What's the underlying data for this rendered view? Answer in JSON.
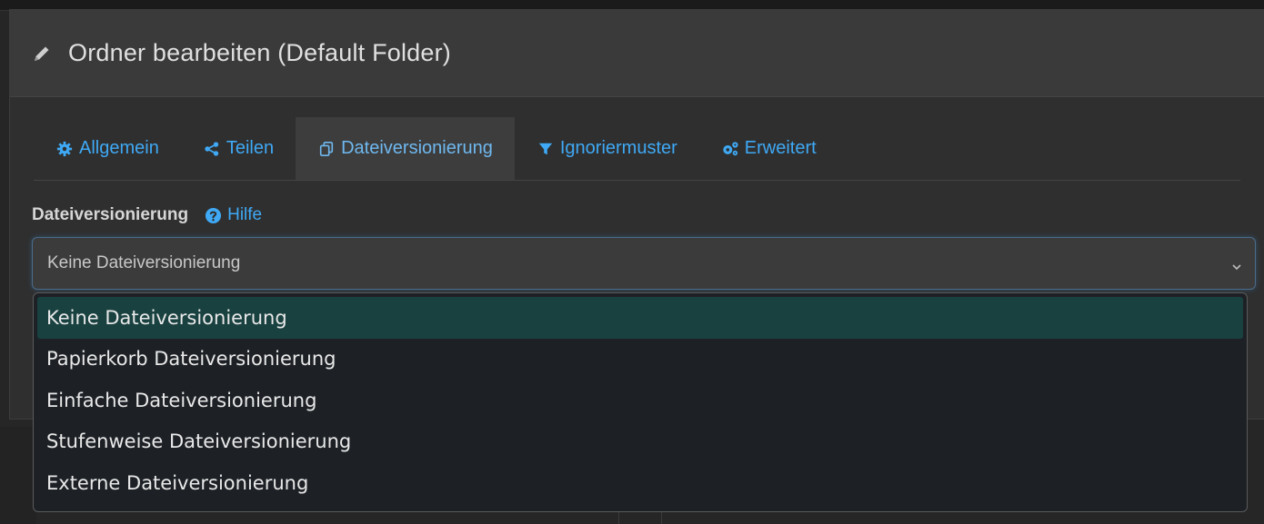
{
  "modal": {
    "title": "Ordner bearbeiten (Default Folder)"
  },
  "tabs": [
    {
      "label": "Allgemein",
      "icon": "gear-icon",
      "active": false
    },
    {
      "label": "Teilen",
      "icon": "share-icon",
      "active": false
    },
    {
      "label": "Dateiversionierung",
      "icon": "copy-icon",
      "active": true
    },
    {
      "label": "Ignoriermuster",
      "icon": "filter-icon",
      "active": false
    },
    {
      "label": "Erweitert",
      "icon": "gears-icon",
      "active": false
    }
  ],
  "field": {
    "label": "Dateiversionierung",
    "help_label": "Hilfe"
  },
  "select": {
    "value": "Keine Dateiversionierung",
    "options": [
      "Keine Dateiversionierung",
      "Papierkorb Dateiversionierung",
      "Einfache Dateiversionierung",
      "Stufenweise Dateiversionierung",
      "Externe Dateiversionierung"
    ],
    "selected_index": 0
  },
  "colors": {
    "link": "#3fa9f5",
    "selected_option_bg": "#194140",
    "header_bg": "#3a3a3a",
    "modal_bg": "#2f2f2f"
  }
}
